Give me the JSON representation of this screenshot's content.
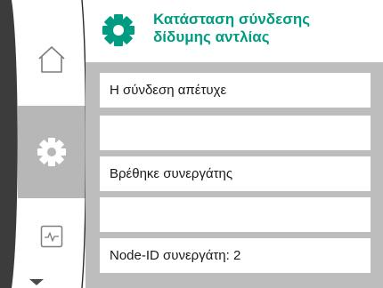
{
  "header": {
    "title_line1": "Κατάσταση σύνδεσης",
    "title_line2": "δίδυμης αντλίας",
    "icon": "gear-icon",
    "title_color": "#009c82"
  },
  "rail": {
    "items": [
      {
        "icon": "home-icon",
        "active": false
      },
      {
        "icon": "settings-gear-icon",
        "active": true
      },
      {
        "icon": "diagnostics-monitor-icon",
        "active": false
      }
    ],
    "scroll_indicator": "chevron-down-icon"
  },
  "rows": [
    {
      "text": "Η σύνδεση απέτυχε"
    },
    {
      "text": ""
    },
    {
      "text": "Βρέθηκε συνεργάτης"
    },
    {
      "text": ""
    },
    {
      "text": "Node-ID συνεργάτη: 2"
    }
  ],
  "colors": {
    "accent": "#009c82",
    "rail_active": "#b7b7b7",
    "content_bg": "#bdbdbd"
  }
}
